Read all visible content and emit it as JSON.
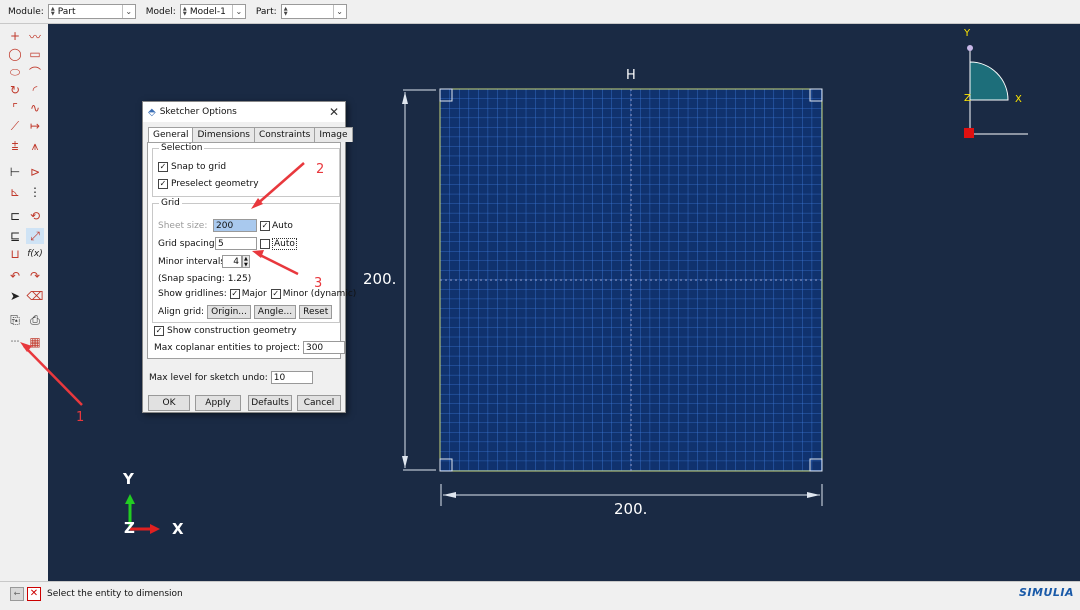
{
  "toolbar": {
    "module_label": "Module:",
    "module_value": "Part",
    "model_label": "Model:",
    "model_value": "Model-1",
    "part_label": "Part:",
    "part_value": ""
  },
  "viewport": {
    "background": "#1a2a44",
    "top_label": "H",
    "left_dimension": "200.",
    "bottom_dimension": "200.",
    "triad_y": "Y",
    "triad_z": "Z",
    "triad_x": "X",
    "view_triad_y": "Y",
    "view_triad_z": "Z",
    "view_triad_x": "X"
  },
  "dialog": {
    "title": "Sketcher Options",
    "tabs": [
      "General",
      "Dimensions",
      "Constraints",
      "Image"
    ],
    "active_tab": "General",
    "selection_group": "Selection",
    "snap_to_grid": "Snap to grid",
    "snap_to_grid_checked": true,
    "preselect_geometry": "Preselect geometry",
    "preselect_geometry_checked": true,
    "grid_group": "Grid",
    "sheet_size_label": "Sheet size:",
    "sheet_size_value": "200",
    "sheet_auto_label": "Auto",
    "sheet_auto_checked": true,
    "grid_spacing_label": "Grid spacing:",
    "grid_spacing_value": "5",
    "spacing_auto_label": "Auto",
    "spacing_auto_checked": false,
    "minor_intervals_label": "Minor intervals:",
    "minor_intervals_value": "4",
    "snap_spacing": "(Snap spacing: 1.25)",
    "show_gridlines_label": "Show gridlines:",
    "major_label": "Major",
    "major_checked": true,
    "minor_label": "Minor (dynamic)",
    "minor_checked": true,
    "align_grid_label": "Align grid:",
    "origin_button": "Origin...",
    "angle_button": "Angle...",
    "reset_button": "Reset",
    "show_construction": "Show construction geometry",
    "show_construction_checked": true,
    "max_coplanar_label": "Max coplanar entities to project:",
    "max_coplanar_value": "300",
    "max_undo_label": "Max level for sketch undo:",
    "max_undo_value": "10",
    "ok_button": "OK",
    "apply_button": "Apply",
    "defaults_button": "Defaults",
    "cancel_button": "Cancel"
  },
  "annotations": {
    "one": "1",
    "two": "2",
    "three": "3",
    "color": "#e8383d"
  },
  "prompt": {
    "message": "Select the entity to dimension",
    "brand": "SIMULIA"
  }
}
